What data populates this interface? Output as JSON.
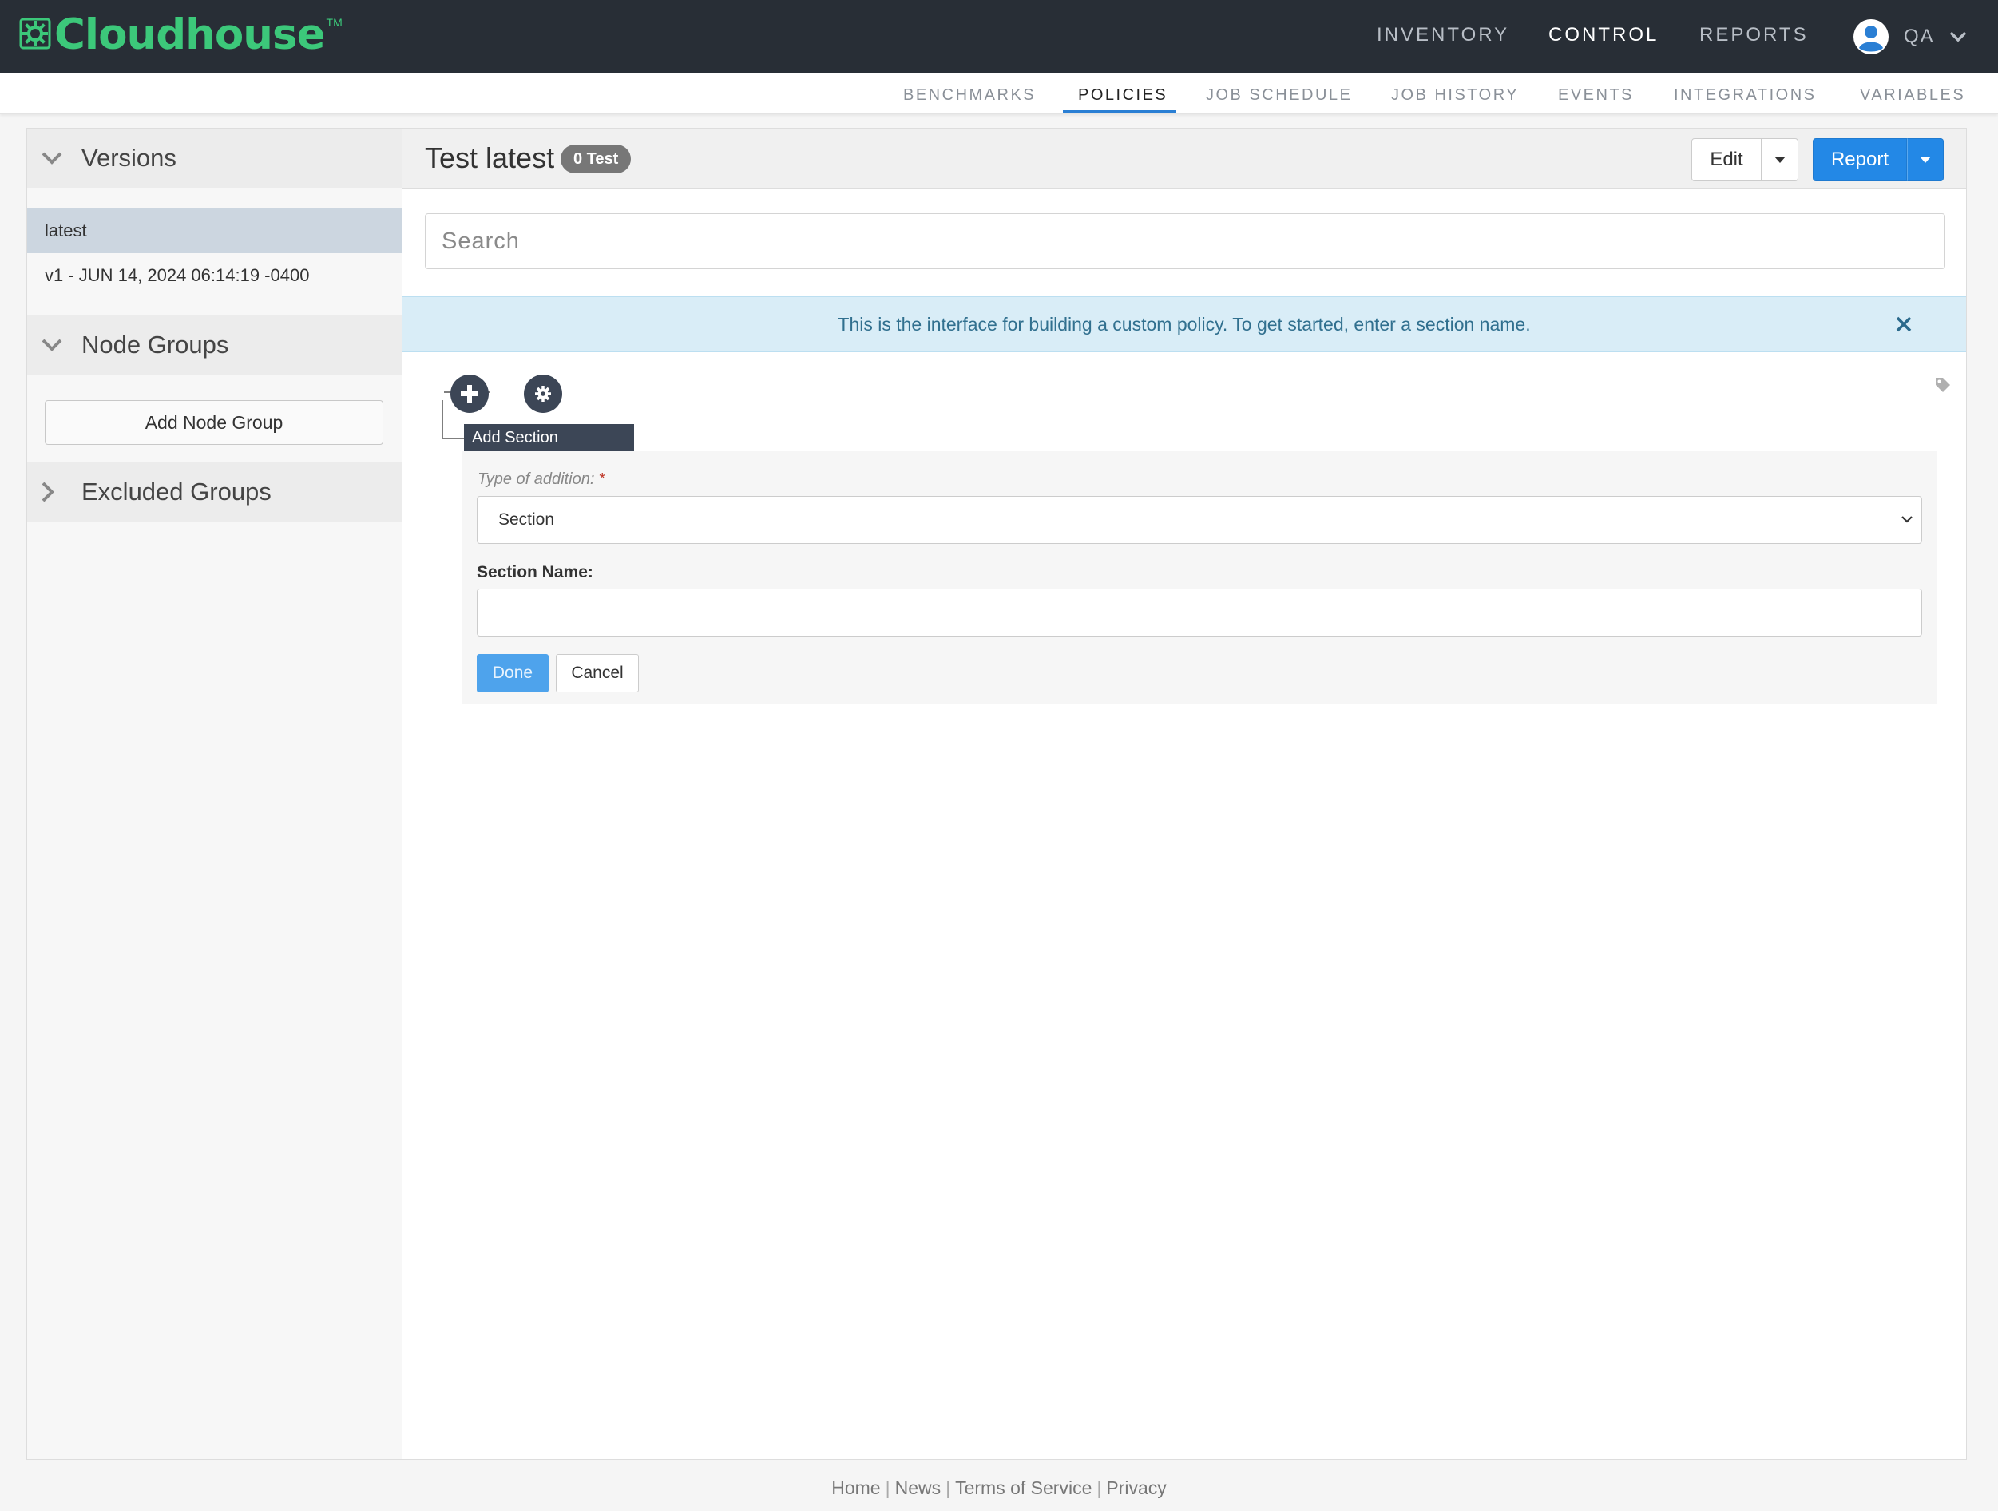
{
  "brand": {
    "name": "Cloudhouse",
    "tm": "TM",
    "color": "#3cc87a"
  },
  "topnav": {
    "items": [
      {
        "label": "INVENTORY",
        "active": false
      },
      {
        "label": "CONTROL",
        "active": true
      },
      {
        "label": "REPORTS",
        "active": false
      }
    ],
    "user": {
      "label": "QA",
      "icon": "user-avatar-icon"
    }
  },
  "subnav": {
    "items": [
      {
        "label": "BENCHMARKS",
        "active": false
      },
      {
        "label": "POLICIES",
        "active": true
      },
      {
        "label": "JOB SCHEDULE",
        "active": false
      },
      {
        "label": "JOB HISTORY",
        "active": false
      },
      {
        "label": "EVENTS",
        "active": false
      },
      {
        "label": "INTEGRATIONS",
        "active": false
      },
      {
        "label": "VARIABLES",
        "active": false
      }
    ],
    "active_color": "#2a7fd4"
  },
  "sidebar": {
    "versions": {
      "title": "Versions",
      "items": [
        {
          "label": "latest",
          "selected": true
        },
        {
          "label": "v1 - JUN 14, 2024 06:14:19 -0400",
          "selected": false
        }
      ]
    },
    "node_groups": {
      "title": "Node Groups",
      "add_button": "Add Node Group"
    },
    "excluded_groups": {
      "title": "Excluded Groups"
    }
  },
  "main": {
    "title": "Test latest",
    "badge": "0 Test",
    "edit_label": "Edit",
    "report_label": "Report",
    "search_placeholder": "Search",
    "alert": "This is the interface for building a custom policy. To get started, enter a section name.",
    "tooltip": "Add Section",
    "form": {
      "type_label": "Type of addition:",
      "required_mark": "*",
      "type_value": "Section",
      "section_name_label": "Section Name:",
      "section_name_value": "",
      "done_label": "Done",
      "cancel_label": "Cancel"
    }
  },
  "footer": {
    "links": [
      "Home",
      "News",
      "Terms of Service",
      "Privacy"
    ],
    "separator": "|"
  }
}
